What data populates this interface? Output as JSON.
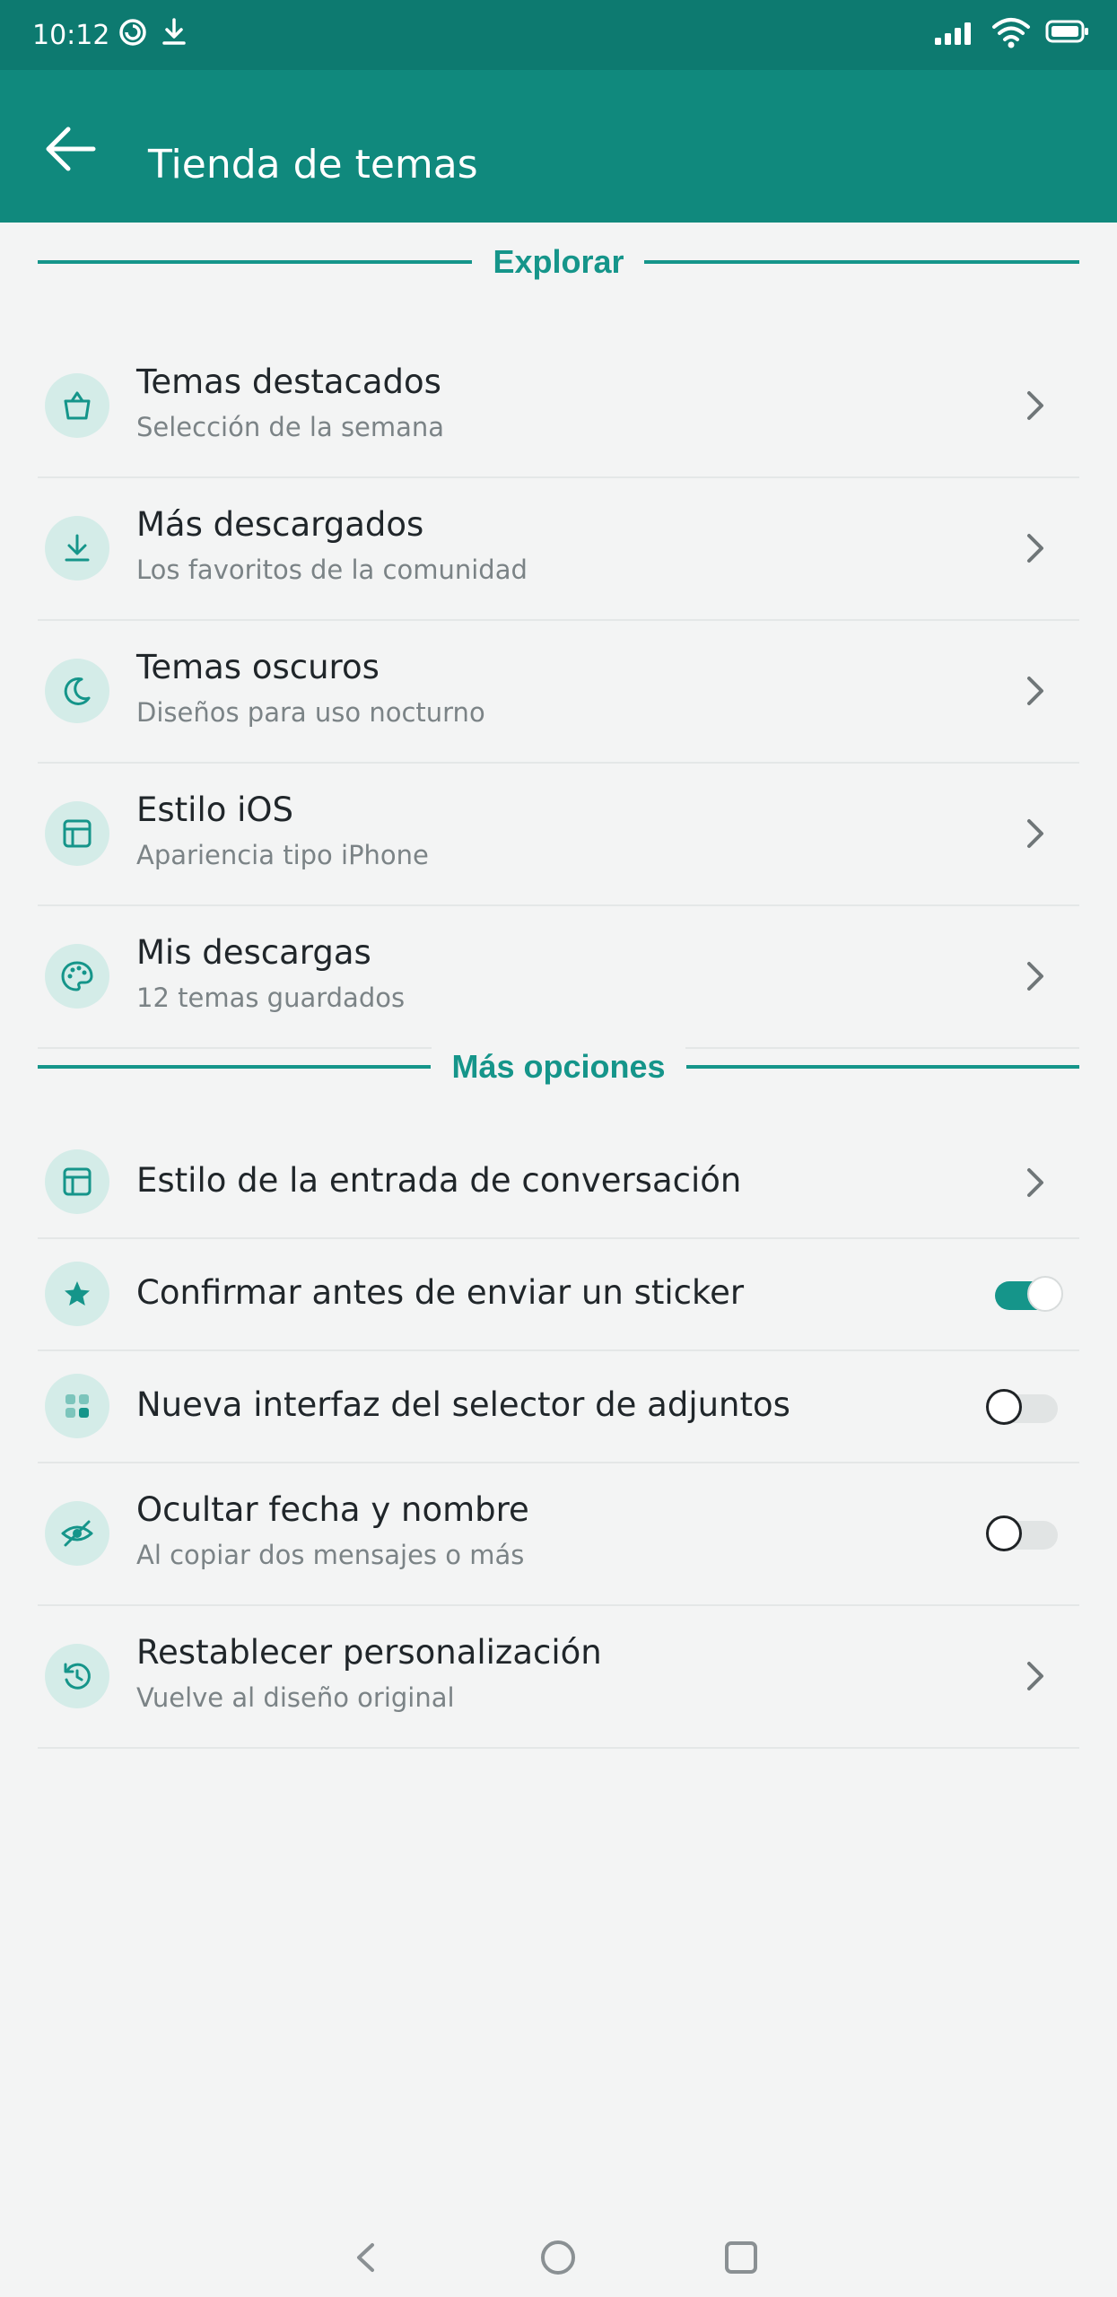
{
  "colors": {
    "status_bar": "#0d7a70",
    "app_bar": "#10897d",
    "accent": "#15958a",
    "icon_bg": "#d4ece8",
    "background": "#f3f4f4"
  },
  "status_bar": {
    "time": "10:12",
    "icons": [
      "sync-icon",
      "download-icon",
      "signal-icon",
      "wifi-icon",
      "battery-icon"
    ]
  },
  "app_bar": {
    "back_icon": "arrow-left-icon",
    "title": "Tienda de temas"
  },
  "sections": {
    "explore": {
      "title": "Explorar",
      "items": [
        {
          "icon": "shopping-bag-icon",
          "title": "Temas destacados",
          "subtitle": "Selección de la semana"
        },
        {
          "icon": "download-icon",
          "title": "Más descargados",
          "subtitle": "Los favoritos de la comunidad"
        },
        {
          "icon": "moon-icon",
          "title": "Temas oscuros",
          "subtitle": "Diseños para uso nocturno"
        },
        {
          "icon": "layout-icon",
          "title": "Estilo iOS",
          "subtitle": "Apariencia tipo iPhone"
        },
        {
          "icon": "palette-icon",
          "title": "Mis descargas",
          "subtitle": "12 temas guardados"
        }
      ]
    },
    "more": {
      "title": "Más opciones",
      "items": [
        {
          "icon": "layout-icon",
          "title": "Estilo de la entrada de conversación",
          "control": "chevron"
        },
        {
          "icon": "star-icon",
          "title": "Confirmar antes de enviar un sticker",
          "control": "toggle",
          "enabled": true
        },
        {
          "icon": "grid-icon",
          "title": "Nueva interfaz del selector de adjuntos",
          "control": "toggle",
          "enabled": false
        },
        {
          "icon": "eye-off-icon",
          "title": "Ocultar fecha y nombre",
          "subtitle": "Al copiar dos mensajes o más",
          "control": "toggle",
          "enabled": false
        },
        {
          "icon": "reset-icon",
          "title": "Restablecer personalización",
          "subtitle": "Vuelve al diseño original",
          "control": "chevron"
        }
      ]
    }
  },
  "nav_bar": {
    "buttons": [
      "back-triangle-icon",
      "home-circle-icon",
      "recents-square-icon"
    ]
  }
}
